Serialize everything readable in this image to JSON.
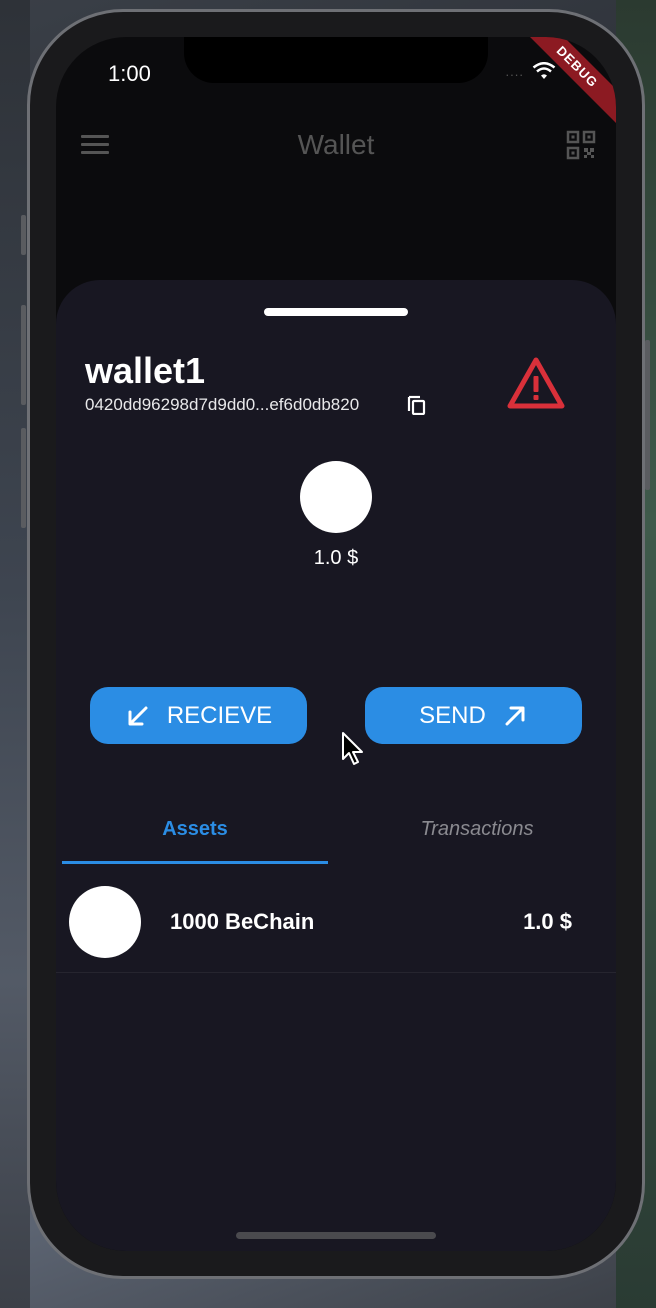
{
  "status_bar": {
    "time": "1:00",
    "signal": "....",
    "debug_banner": "DEBUG"
  },
  "appbar": {
    "title": "Wallet",
    "menu_icon": "hamburger-menu-icon",
    "qr_icon": "qr-scan-icon"
  },
  "wallet": {
    "name": "wallet1",
    "address": "0420dd96298d7d9dd0...ef6d0db820",
    "balance": "1.0 $",
    "warning_color": "#d9303a"
  },
  "actions": {
    "receive_label": "RECIEVE",
    "send_label": "SEND"
  },
  "tabs": [
    {
      "label": "Assets",
      "selected": true
    },
    {
      "label": "Transactions",
      "selected": false
    }
  ],
  "assets": [
    {
      "name": "1000 BeChain",
      "value": "1.0 $"
    }
  ],
  "colors": {
    "accent": "#2b8de4",
    "sheet": "#181722",
    "background": "#0b0b0d"
  }
}
